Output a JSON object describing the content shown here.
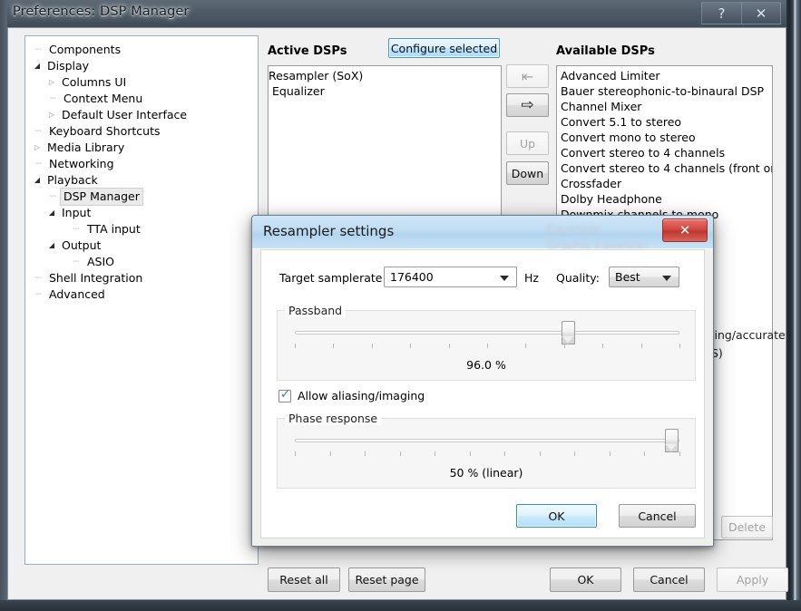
{
  "window": {
    "title": "Preferences: DSP Manager",
    "help_button": "?",
    "close_button": "✕"
  },
  "sidebar": {
    "items": [
      {
        "label": "Components",
        "indent": 0,
        "arrow": "none",
        "selected": false
      },
      {
        "label": "Display",
        "indent": 0,
        "arrow": "open",
        "selected": false
      },
      {
        "label": "Columns UI",
        "indent": 1,
        "arrow": "closed",
        "selected": false
      },
      {
        "label": "Context Menu",
        "indent": 1,
        "arrow": "none",
        "selected": false
      },
      {
        "label": "Default User Interface",
        "indent": 1,
        "arrow": "closed",
        "selected": false
      },
      {
        "label": "Keyboard Shortcuts",
        "indent": 0,
        "arrow": "none",
        "selected": false
      },
      {
        "label": "Media Library",
        "indent": 0,
        "arrow": "closed",
        "selected": false
      },
      {
        "label": "Networking",
        "indent": 0,
        "arrow": "none",
        "selected": false
      },
      {
        "label": "Playback",
        "indent": 0,
        "arrow": "open",
        "selected": false
      },
      {
        "label": "DSP Manager",
        "indent": 1,
        "arrow": "none",
        "selected": true
      },
      {
        "label": "Input",
        "indent": 1,
        "arrow": "open",
        "selected": false
      },
      {
        "label": "TTA input",
        "indent": 2,
        "arrow": "none",
        "selected": false
      },
      {
        "label": "Output",
        "indent": 1,
        "arrow": "open",
        "selected": false
      },
      {
        "label": "ASIO",
        "indent": 2,
        "arrow": "none",
        "selected": false
      },
      {
        "label": "Shell Integration",
        "indent": 0,
        "arrow": "none",
        "selected": false
      },
      {
        "label": "Advanced",
        "indent": 0,
        "arrow": "none",
        "selected": false
      }
    ]
  },
  "main": {
    "active_dsps_header": "Active DSPs",
    "configure_selected_button": "Configure selected",
    "active_dsps": [
      {
        "label": "Resampler (SoX)",
        "selected": true
      },
      {
        "label": "Equalizer",
        "selected": false
      }
    ],
    "transfer_buttons": {
      "remove_label": "⇤",
      "add_label": "⇨",
      "up_label": "Up",
      "down_label": "Down"
    },
    "available_dsps_header": "Available DSPs",
    "available_dsps": [
      "Advanced Limiter",
      "Bauer stereophonic-to-binaural DSP",
      "Channel Mixer",
      "Convert 5.1 to stereo",
      "Convert mono to stereo",
      "Convert stereo to 4 channels",
      "Convert stereo to 4 channels (front only)",
      "Crossfader",
      "Dolby Headphone",
      "Downmix channels to mono"
    ],
    "obscured_text_1": "ling/accurate",
    "obscured_text_2": "S)",
    "ghost_text_1": "Equalizer",
    "ghost_text_2": "Graphic Equalizer",
    "delete_button": "Delete"
  },
  "footer": {
    "reset_all": "Reset all",
    "reset_page": "Reset page",
    "ok": "OK",
    "cancel": "Cancel",
    "apply": "Apply"
  },
  "dialog": {
    "title": "Resampler settings",
    "close_button": "✕",
    "samplerate_label": "Target samplerate:",
    "samplerate_value": "176400",
    "samplerate_unit": "Hz",
    "quality_label": "Quality:",
    "quality_value": "Best",
    "passband": {
      "group_label": "Passband",
      "value_text": "96.0 %",
      "thumb_percent": 71,
      "tick_count": 11
    },
    "allow_aliasing_label": "Allow aliasing/imaging",
    "allow_aliasing_checked": true,
    "phase": {
      "group_label": "Phase response",
      "value_text": "50 % (linear)",
      "thumb_percent": 98,
      "tick_count": 12
    },
    "ok": "OK",
    "cancel": "Cancel"
  }
}
